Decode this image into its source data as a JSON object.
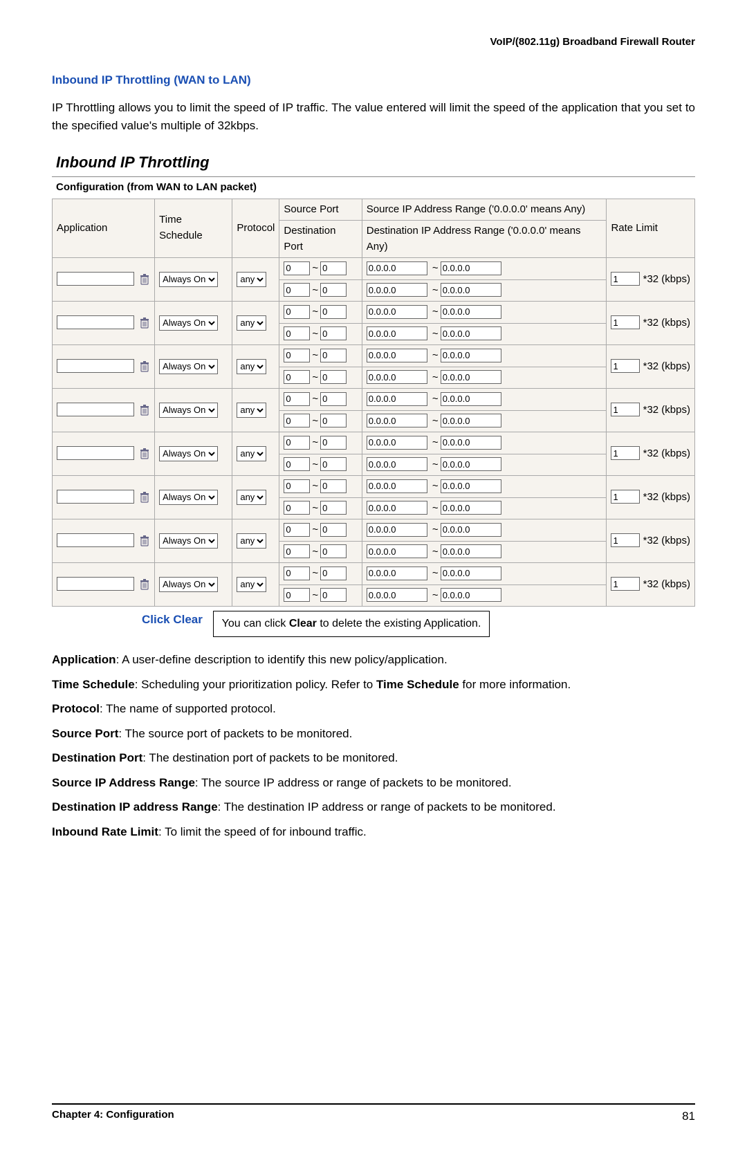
{
  "doc_header": "VoIP/(802.11g)  Broadband  Firewall  Router",
  "section_title": "Inbound IP Throttling (WAN to LAN)",
  "intro_text": "IP Throttling allows you to limit the speed of IP traffic. The value entered will limit the speed of the application that you set to the specified value's multiple of 32kbps.",
  "panel": {
    "title": "Inbound IP Throttling",
    "subtitle": "Configuration (from WAN to LAN packet)",
    "headers": {
      "application": "Application",
      "time_schedule": "Time Schedule",
      "protocol": "Protocol",
      "source_port": "Source Port",
      "dest_port": "Destination Port",
      "src_ip": "Source IP Address Range ('0.0.0.0' means Any)",
      "dst_ip": "Destination IP Address Range ('0.0.0.0' means Any)",
      "rate_limit": "Rate Limit"
    },
    "row_defaults": {
      "time_schedule": "Always On",
      "protocol": "any",
      "port_from": "0",
      "port_to": "0",
      "ip_from": "0.0.0.0",
      "ip_to": "0.0.0.0",
      "rate": "1",
      "rate_unit": "*32 (kbps)"
    },
    "row_count": 8
  },
  "callout": {
    "label": "Click Clear",
    "text_prefix": "You can click ",
    "text_bold": "Clear",
    "text_suffix": " to delete the existing Application."
  },
  "definitions": [
    {
      "term": "Application",
      "desc": ": A user-define description to identify this new policy/application."
    },
    {
      "term": "Time Schedule",
      "desc": ": Scheduling your prioritization policy.    Refer to ",
      "bold2": "Time Schedule",
      "desc2": " for more information."
    },
    {
      "term": "Protocol",
      "desc": ": The name of supported protocol."
    },
    {
      "term": "Source Port",
      "desc": ": The source port of packets to be monitored."
    },
    {
      "term": "Destination Port",
      "desc": ": The destination port of packets to be monitored."
    },
    {
      "term": "Source IP Address Range",
      "desc": ": The source IP address or range of packets to be monitored."
    },
    {
      "term": "Destination IP address Range",
      "desc": ": The destination IP address or range of packets to be monitored."
    },
    {
      "term": "Inbound Rate Limit",
      "desc": ": To limit the speed of for inbound traffic."
    }
  ],
  "footer": {
    "chapter": "Chapter 4: Configuration",
    "page": "81"
  }
}
